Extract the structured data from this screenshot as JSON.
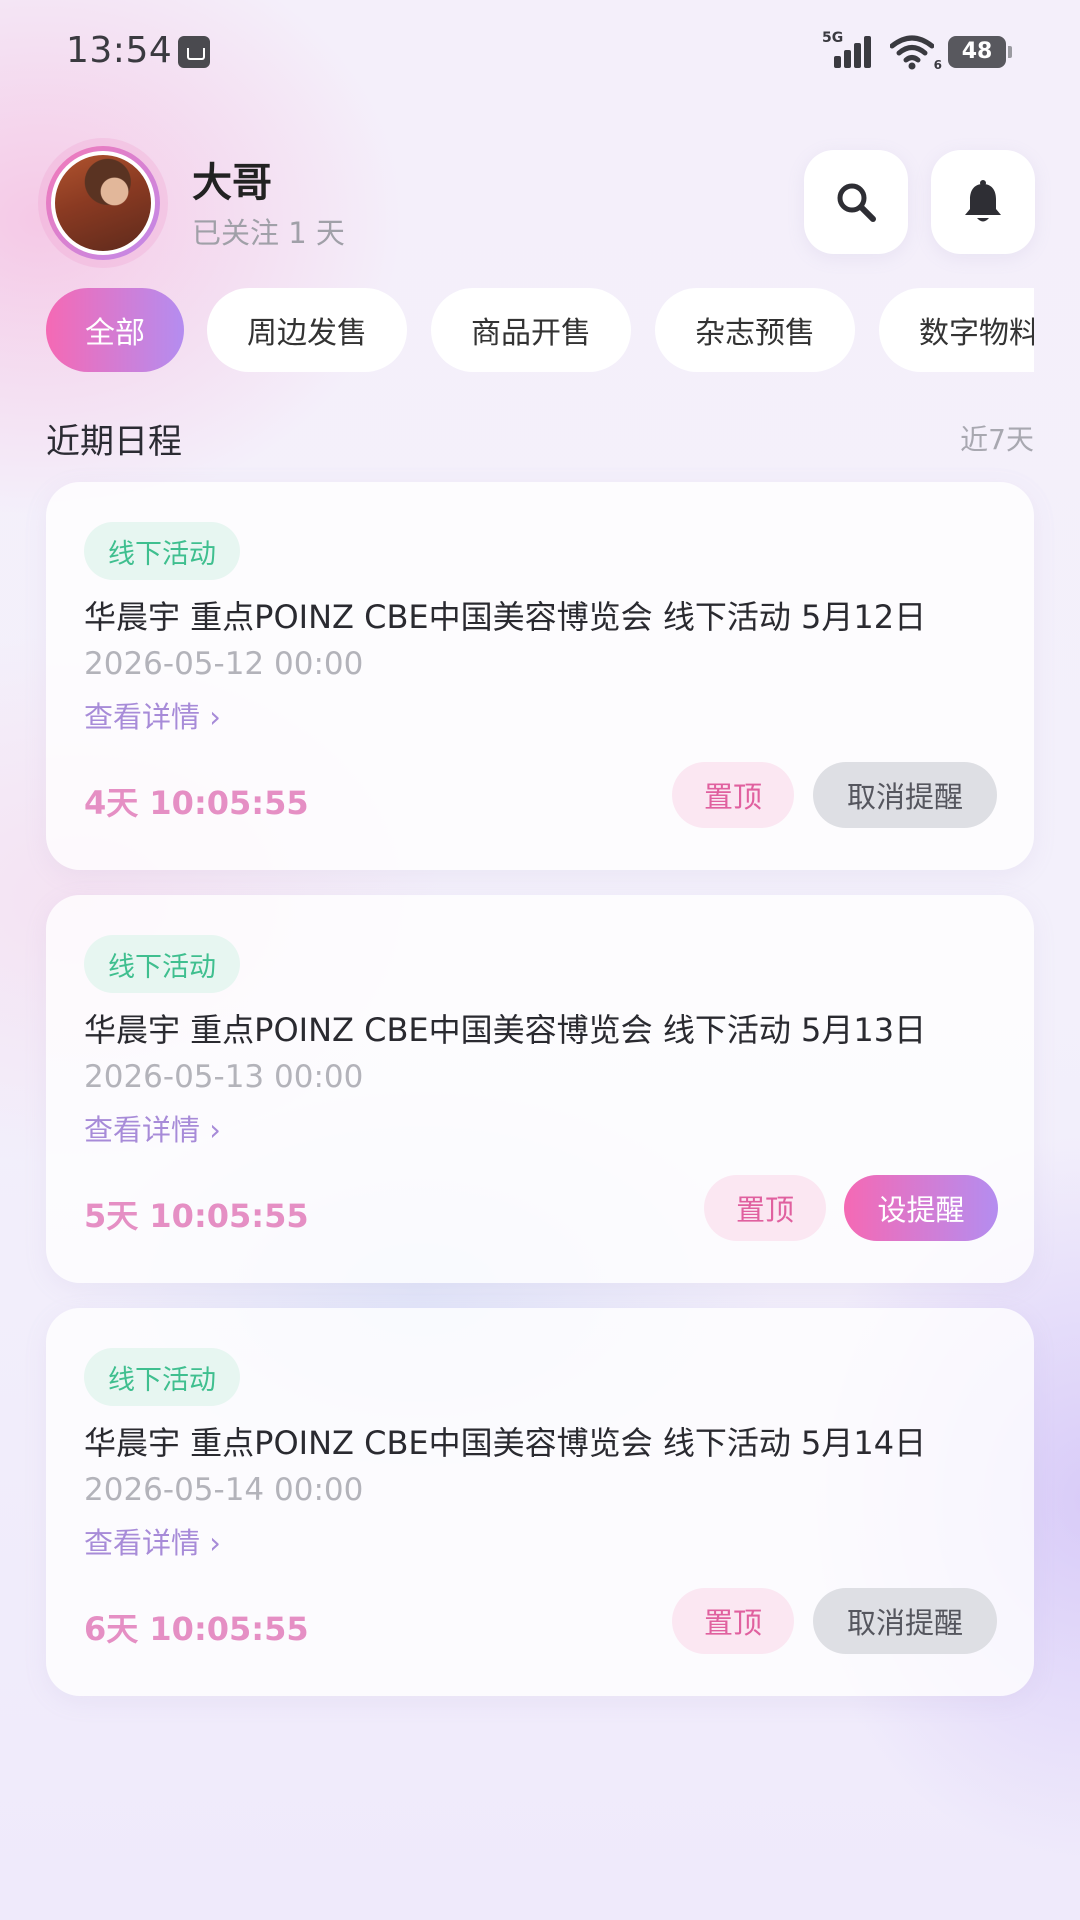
{
  "status_bar": {
    "time": "13:54",
    "network": "5G",
    "wifi_badge": "6",
    "battery": "48"
  },
  "header": {
    "user_name": "大哥",
    "follow_text": "已关注 1 天",
    "search_icon": "search-icon",
    "notification_icon": "bell-icon"
  },
  "filters": [
    {
      "label": "全部",
      "active": true
    },
    {
      "label": "周边发售",
      "active": false
    },
    {
      "label": "商品开售",
      "active": false
    },
    {
      "label": "杂志预售",
      "active": false
    },
    {
      "label": "数字物料",
      "active": false
    }
  ],
  "section": {
    "title": "近期日程",
    "range": "近7天"
  },
  "events": [
    {
      "tag": "线下活动",
      "title": "华晨宇 重点POINZ CBE中国美容博览会 线下活动 5月12日",
      "datetime": "2026-05-12 00:00",
      "detail_link": "查看详情 ›",
      "countdown": "4天 10:05:55",
      "pin_label": "置顶",
      "reminder_label": "取消提醒",
      "reminder_set": true
    },
    {
      "tag": "线下活动",
      "title": "华晨宇 重点POINZ CBE中国美容博览会 线下活动 5月13日",
      "datetime": "2026-05-13 00:00",
      "detail_link": "查看详情 ›",
      "countdown": "5天 10:05:55",
      "pin_label": "置顶",
      "reminder_label": "设提醒",
      "reminder_set": false
    },
    {
      "tag": "线下活动",
      "title": "华晨宇 重点POINZ CBE中国美容博览会 线下活动 5月14日",
      "datetime": "2026-05-14 00:00",
      "detail_link": "查看详情 ›",
      "countdown": "6天 10:05:55",
      "pin_label": "置顶",
      "reminder_label": "取消提醒",
      "reminder_set": true
    }
  ],
  "colors": {
    "accent_pink": "#f569b4",
    "accent_purple": "#b48df0",
    "tag_green": "#3fbf8f",
    "link_purple": "#a78bd8",
    "countdown_pink": "#e58fc4"
  }
}
